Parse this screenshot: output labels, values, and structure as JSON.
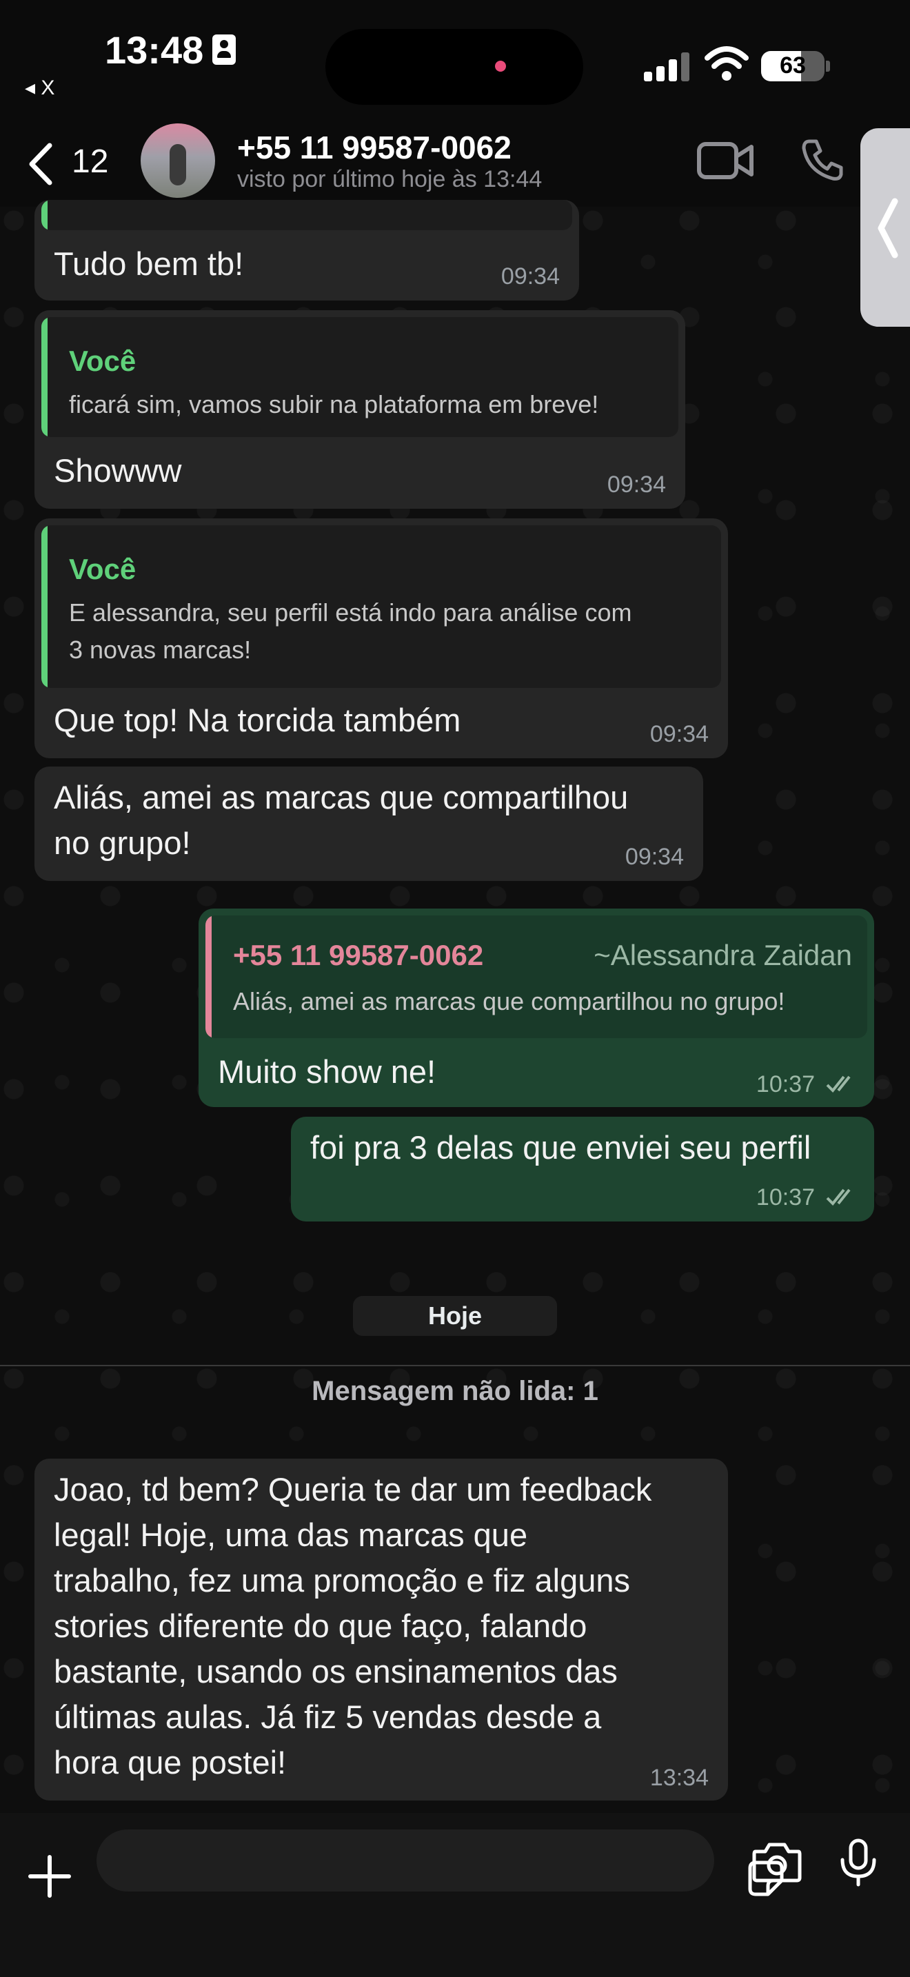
{
  "status_bar": {
    "time": "13:48",
    "back_app": "◂ X",
    "battery": "63",
    "battery_level": 0.63
  },
  "header": {
    "back_count": "12",
    "contact_name": "+55 11 99587-0062",
    "last_seen": "visto por último hoje às 13:44"
  },
  "messages": [
    {
      "text": "Tudo bem tb!",
      "time": "09:34"
    },
    {
      "quote_author": "Você",
      "quote_text": "ficará sim, vamos subir na plataforma em breve!",
      "text": "Showww",
      "time": "09:34"
    },
    {
      "quote_author": "Você",
      "quote_text": "E alessandra, seu perfil está indo para análise com\n3 novas marcas!",
      "text": "Que top! Na torcida também",
      "time": "09:34"
    },
    {
      "text": "Aliás, amei as marcas que compartilhou\nno grupo!",
      "time": "09:34"
    },
    {
      "quote_author": "+55 11 99587-0062",
      "quote_alias": "~Alessandra Zaidan",
      "quote_text": "Aliás, amei as marcas que compartilhou no grupo!",
      "text": "Muito show ne!",
      "time": "10:37"
    },
    {
      "text": "foi pra 3 delas que enviei seu perfil",
      "time": "10:37"
    },
    {
      "text": "Joao, td bem? Queria te dar um feedback\nlegal! Hoje, uma das marcas que\ntrabalho, fez uma promoção e fiz alguns\nstories diferente do que faço, falando\nbastante, usando os ensinamentos das\núltimas aulas. Já fiz 5 vendas desde a\nhora que postei!",
      "time": "13:34"
    }
  ],
  "date_separator": "Hoje",
  "unread_banner": "Mensagem não lida: 1",
  "input": {
    "placeholder": ""
  },
  "colors": {
    "incoming_bubble": "#262626",
    "outgoing_bubble": "#1e4530",
    "you_author": "#5fd17a",
    "contact_author": "#e4869a"
  }
}
